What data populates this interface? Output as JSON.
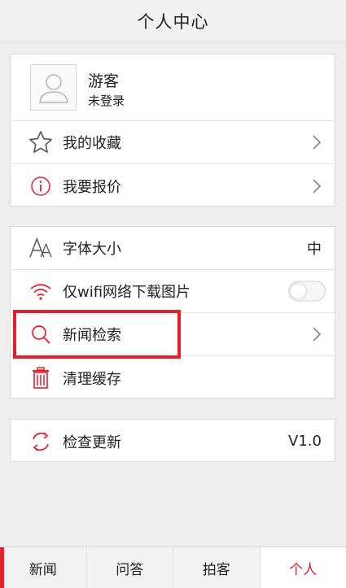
{
  "header": {
    "title": "个人中心"
  },
  "profile": {
    "name": "游客",
    "status": "未登录"
  },
  "card1": {
    "favorites_label": "我的收藏",
    "quote_label": "我要报价"
  },
  "card2": {
    "font_size_label": "字体大小",
    "font_size_value": "中",
    "wifi_only_label": "仅wifi网络下载图片",
    "wifi_only_enabled": false,
    "news_search_label": "新闻检索",
    "clear_cache_label": "清理缓存"
  },
  "card3": {
    "check_update_label": "检查更新",
    "version_value": "V1.0"
  },
  "tabs": [
    {
      "label": "新闻"
    },
    {
      "label": "问答"
    },
    {
      "label": "拍客"
    },
    {
      "label": "个人"
    }
  ],
  "colors": {
    "accent": "#e3202c",
    "icon_gray": "#555555"
  },
  "icons": {
    "avatar": "user-silhouette-icon",
    "favorites": "star-icon",
    "quote": "info-icon",
    "font_size": "font-size-icon",
    "wifi": "wifi-icon",
    "search": "search-icon",
    "clear_cache": "trash-icon",
    "update": "refresh-icon",
    "chevron": "chevron-right-icon"
  }
}
